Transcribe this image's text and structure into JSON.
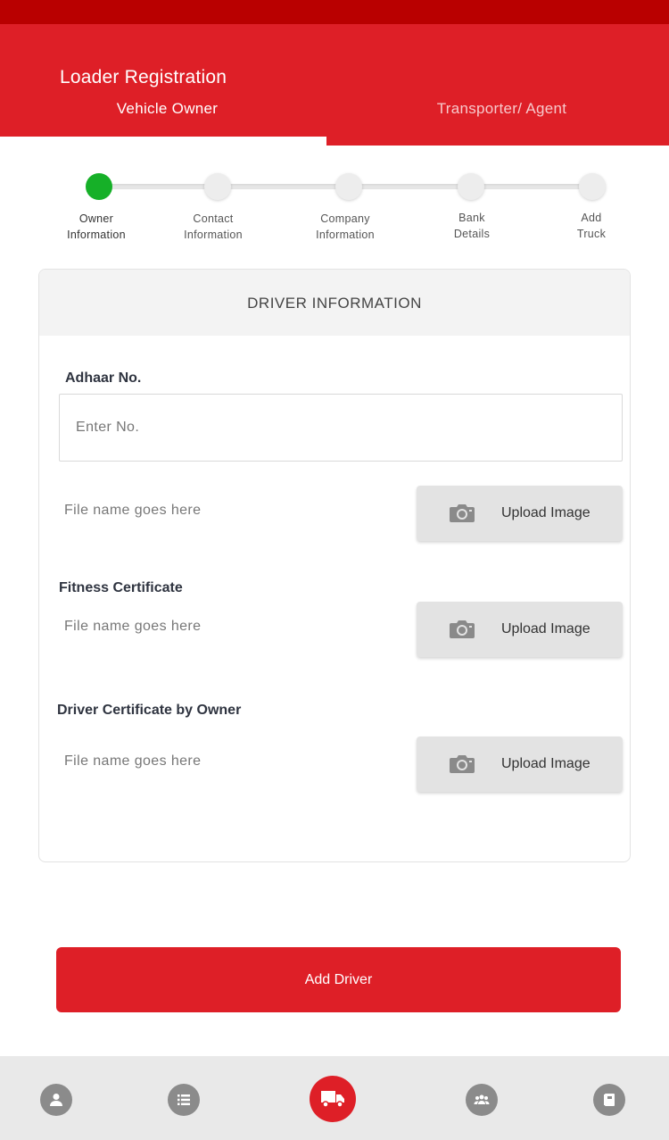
{
  "app": {
    "title": "Loader Registration"
  },
  "tabs": [
    {
      "label": "Vehicle Owner",
      "active": true
    },
    {
      "label": "Transporter/ Agent",
      "active": false
    }
  ],
  "stepper": {
    "current_step": 1,
    "steps": [
      {
        "label": "Owner\nInformation"
      },
      {
        "label": "Contact\nInformation"
      },
      {
        "label": "Company\nInformation"
      },
      {
        "label": "Bank\nDetails"
      },
      {
        "label": "Add\nTruck"
      }
    ]
  },
  "driver_form": {
    "title": "DRIVER INFORMATION",
    "adhaar": {
      "label": "Adhaar No.",
      "placeholder": "Enter No.",
      "value": ""
    },
    "adhaar_upload": {
      "file_name": "File name goes here",
      "button_label": "Upload Image"
    },
    "fitness": {
      "label": "Fitness Certificate",
      "file_name": "File name goes here",
      "button_label": "Upload Image"
    },
    "driver_cert": {
      "label": "Driver Certificate by Owner",
      "file_name": "File name goes here",
      "button_label": "Upload Image"
    }
  },
  "actions": {
    "add_driver": "Add Driver"
  },
  "bottom_nav": {
    "items": [
      "person-icon",
      "list-icon",
      "truck-icon",
      "group-icon",
      "book-icon"
    ],
    "active": "truck-icon"
  },
  "colors": {
    "brand_red": "#de1f27",
    "status_bar": "#b90000",
    "step_active": "#16b028"
  }
}
